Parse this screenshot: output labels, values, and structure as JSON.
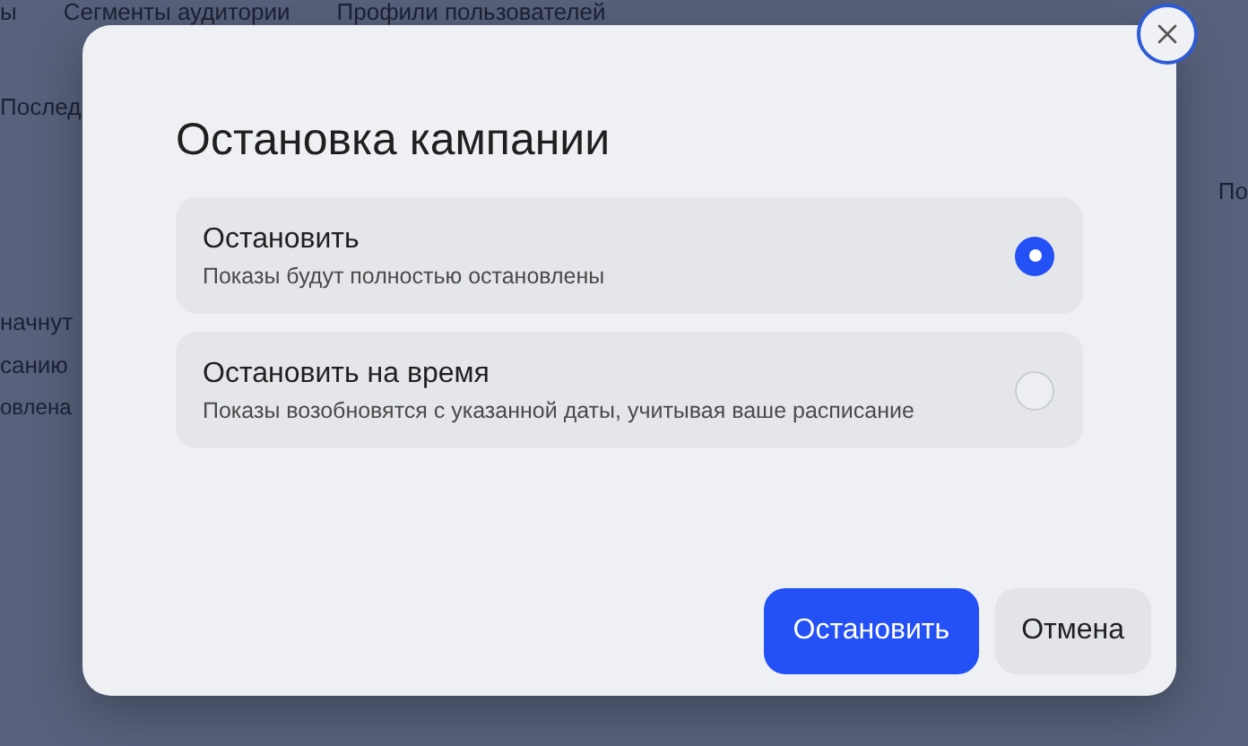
{
  "background": {
    "nav": [
      "ы",
      "Сегменты аудитории",
      "Профили пользователей"
    ],
    "left": [
      "Послед",
      "начнут",
      "санию",
      "овлена"
    ],
    "right": [
      "По"
    ]
  },
  "dialog": {
    "title": "Остановка кампании",
    "options": [
      {
        "label": "Остановить",
        "description": "Показы будут полностью остановлены",
        "selected": true
      },
      {
        "label": "Остановить на время",
        "description": "Показы возобновятся с указанной даты, учитывая ваше расписание",
        "selected": false
      }
    ],
    "buttons": [
      {
        "label": "Остановить",
        "kind": "primary"
      },
      {
        "label": "Отмена",
        "kind": "secondary"
      }
    ]
  }
}
